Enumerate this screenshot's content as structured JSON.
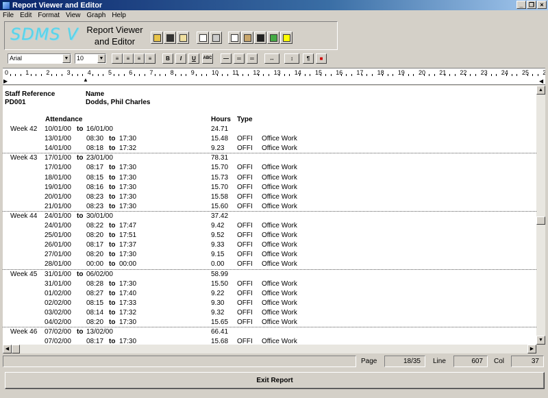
{
  "window": {
    "title": "Report Viewer and Editor"
  },
  "menu": [
    "File",
    "Edit",
    "Format",
    "View",
    "Graph",
    "Help"
  ],
  "banner": {
    "logo": "SDMS V",
    "title_line1": "Report Viewer",
    "title_line2": "and Editor"
  },
  "format_bar": {
    "font": "Arial",
    "size": "10"
  },
  "ruler_numbers": [
    "0",
    "1",
    "2",
    "3",
    "4",
    "5",
    "6",
    "7",
    "8",
    "9",
    "10",
    "11",
    "12",
    "13",
    "14",
    "15",
    "16",
    "17",
    "18",
    "19",
    "20",
    "21",
    "22",
    "23",
    "24",
    "25",
    "26"
  ],
  "report": {
    "header_labels": {
      "staff_ref": "Staff Reference",
      "name": "Name"
    },
    "staff_ref": "PD001",
    "staff_name": "Dodds, Phil Charles",
    "column_labels": {
      "attendance": "Attendance",
      "hours": "Hours",
      "type": "Type"
    },
    "to_word": "to",
    "rows": [
      {
        "week": "Week 42",
        "from": "10/01/00",
        "to": "16/01/00",
        "hours": "24.71"
      },
      {
        "date": "13/01/00",
        "from": "08:30",
        "to": "17:30",
        "hours": "15.48",
        "type": "OFFI",
        "desc": "Office Work"
      },
      {
        "date": "14/01/00",
        "from": "08:18",
        "to": "17:32",
        "hours": "9.23",
        "type": "OFFI",
        "desc": "Office Work"
      },
      {
        "week": "Week 43",
        "from": "17/01/00",
        "to": "23/01/00",
        "hours": "78.31"
      },
      {
        "date": "17/01/00",
        "from": "08:17",
        "to": "17:30",
        "hours": "15.70",
        "type": "OFFI",
        "desc": "Office Work"
      },
      {
        "date": "18/01/00",
        "from": "08:15",
        "to": "17:30",
        "hours": "15.73",
        "type": "OFFI",
        "desc": "Office Work"
      },
      {
        "date": "19/01/00",
        "from": "08:16",
        "to": "17:30",
        "hours": "15.70",
        "type": "OFFI",
        "desc": "Office Work"
      },
      {
        "date": "20/01/00",
        "from": "08:23",
        "to": "17:30",
        "hours": "15.58",
        "type": "OFFI",
        "desc": "Office Work"
      },
      {
        "date": "21/01/00",
        "from": "08:23",
        "to": "17:30",
        "hours": "15.60",
        "type": "OFFI",
        "desc": "Office Work"
      },
      {
        "week": "Week 44",
        "from": "24/01/00",
        "to": "30/01/00",
        "hours": "37.42"
      },
      {
        "date": "24/01/00",
        "from": "08:22",
        "to": "17:47",
        "hours": "9.42",
        "type": "OFFI",
        "desc": "Office Work"
      },
      {
        "date": "25/01/00",
        "from": "08:20",
        "to": "17:51",
        "hours": "9.52",
        "type": "OFFI",
        "desc": "Office Work"
      },
      {
        "date": "26/01/00",
        "from": "08:17",
        "to": "17:37",
        "hours": "9.33",
        "type": "OFFI",
        "desc": "Office Work"
      },
      {
        "date": "27/01/00",
        "from": "08:20",
        "to": "17:30",
        "hours": "9.15",
        "type": "OFFI",
        "desc": "Office Work"
      },
      {
        "date": "28/01/00",
        "from": "00:00",
        "to": "00:00",
        "hours": "0.00",
        "type": "OFFI",
        "desc": "Office Work"
      },
      {
        "week": "Week 45",
        "from": "31/01/00",
        "to": "06/02/00",
        "hours": "58.99"
      },
      {
        "date": "31/01/00",
        "from": "08:28",
        "to": "17:30",
        "hours": "15.50",
        "type": "OFFI",
        "desc": "Office Work"
      },
      {
        "date": "01/02/00",
        "from": "08:27",
        "to": "17:40",
        "hours": "9.22",
        "type": "OFFI",
        "desc": "Office Work"
      },
      {
        "date": "02/02/00",
        "from": "08:15",
        "to": "17:33",
        "hours": "9.30",
        "type": "OFFI",
        "desc": "Office Work"
      },
      {
        "date": "03/02/00",
        "from": "08:14",
        "to": "17:32",
        "hours": "9.32",
        "type": "OFFI",
        "desc": "Office Work"
      },
      {
        "date": "04/02/00",
        "from": "08:20",
        "to": "17:30",
        "hours": "15.65",
        "type": "OFFI",
        "desc": "Office Work"
      },
      {
        "week": "Week 46",
        "from": "07/02/00",
        "to": "13/02/00",
        "hours": "66.41"
      },
      {
        "date": "07/02/00",
        "from": "08:17",
        "to": "17:30",
        "hours": "15.68",
        "type": "OFFI",
        "desc": "Office Work"
      }
    ]
  },
  "status": {
    "page_label": "Page",
    "page": "18/35",
    "line_label": "Line",
    "line": "607",
    "col_label": "Col",
    "col": "37"
  },
  "exit_button": "Exit Report"
}
